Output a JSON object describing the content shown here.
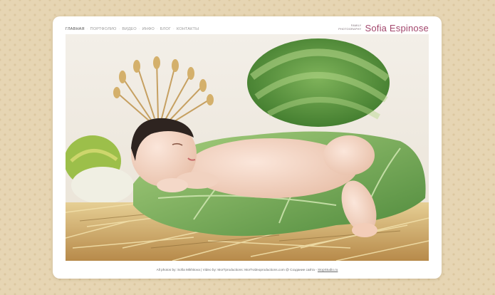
{
  "nav": {
    "items": [
      {
        "label": "ГЛАВНАЯ",
        "active": true
      },
      {
        "label": "ПОРТФОЛИО",
        "active": false
      },
      {
        "label": "ВИДЕО",
        "active": false
      },
      {
        "label": "ИНФО",
        "active": false
      },
      {
        "label": "БЛОГ",
        "active": false
      },
      {
        "label": "КОНТАКТЫ",
        "active": false
      }
    ]
  },
  "brand": {
    "tagline_line1": "FAMILY",
    "tagline_line2": "PHOTOGRAPHY",
    "name": "Sofia  Espinose"
  },
  "footer": {
    "text": "All photos by: Sofia Mikhitova | Video by: MorTproductions: MorTvideoproductions.com @ Создание сайта - ",
    "link": "StopStudio.ru"
  },
  "colors": {
    "accent": "#a2466c",
    "background": "#e6d5b3",
    "card": "#ffffff"
  }
}
